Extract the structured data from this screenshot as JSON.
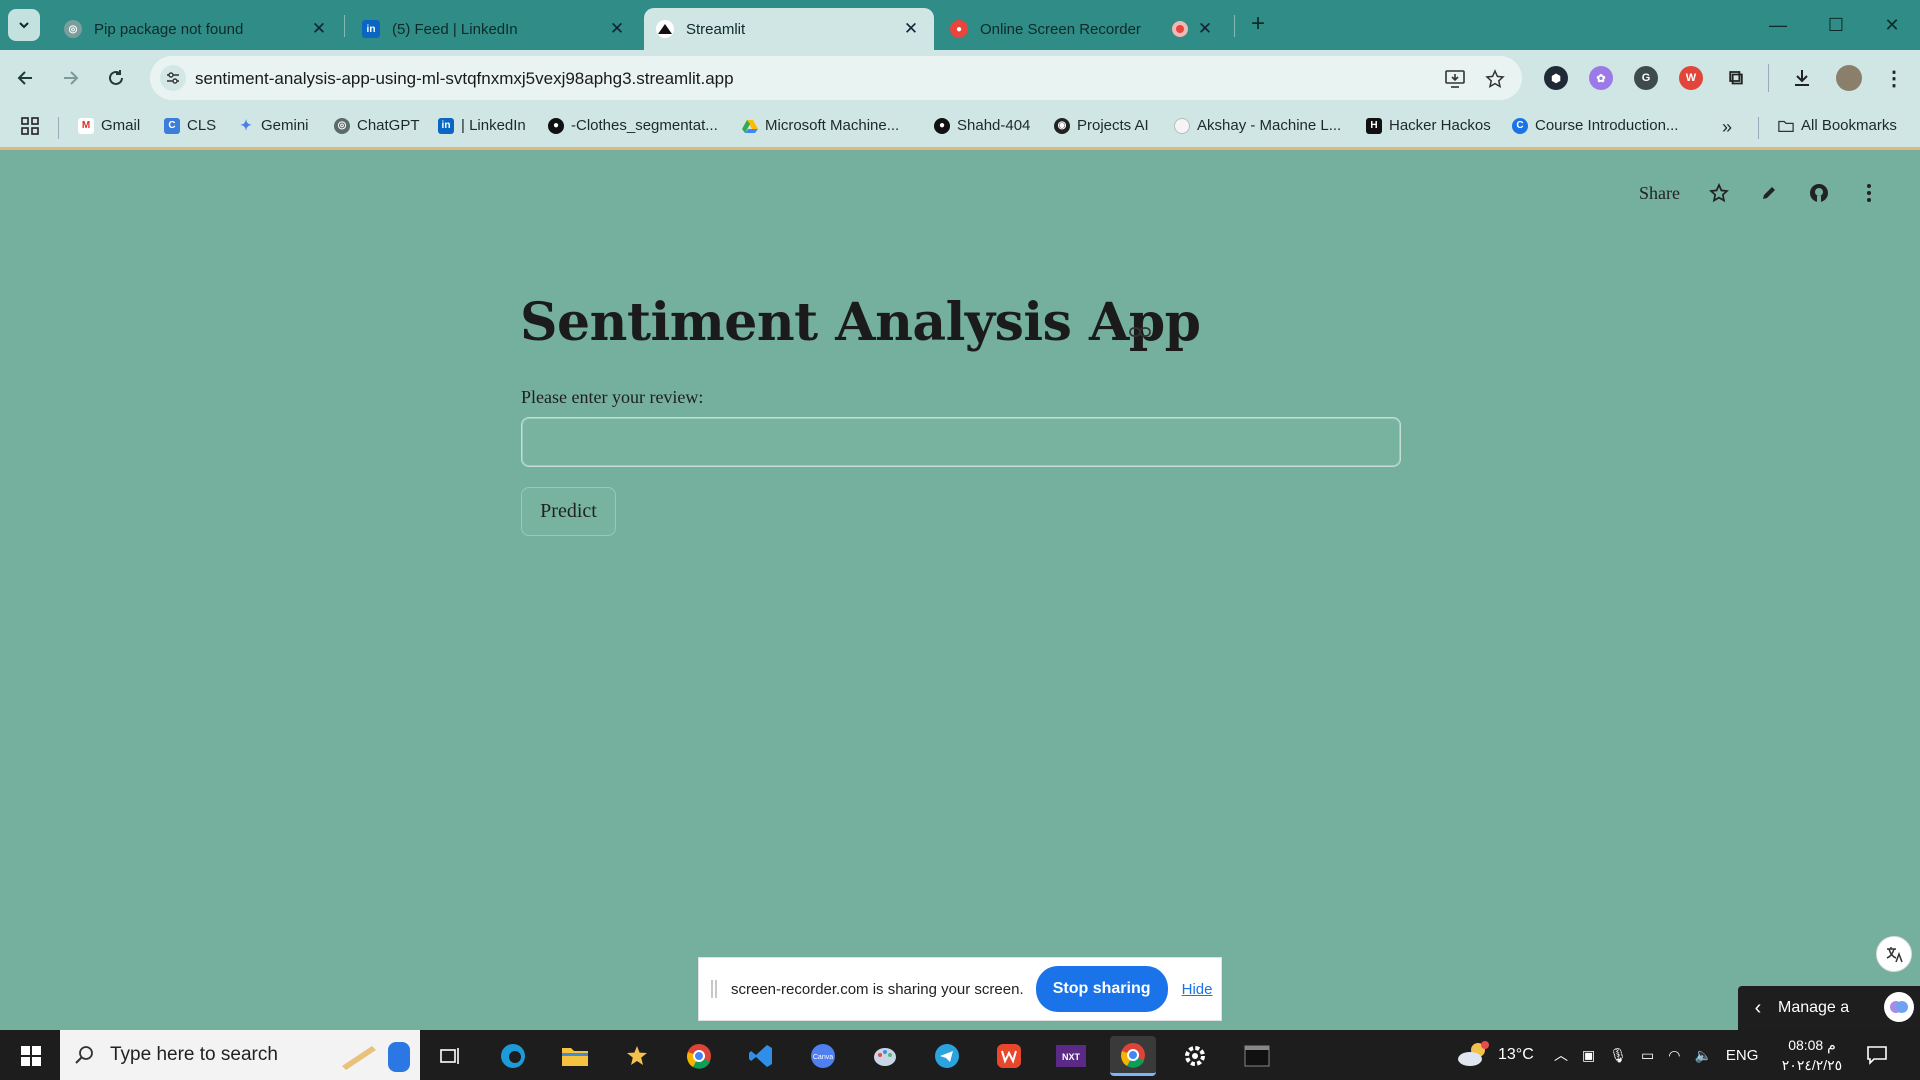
{
  "browser": {
    "tabs": [
      {
        "title": "Pip package not found",
        "active": false
      },
      {
        "title": "(5) Feed | LinkedIn",
        "active": false
      },
      {
        "title": "Streamlit",
        "active": true
      },
      {
        "title": "Online Screen Recorder",
        "active": false
      }
    ],
    "url": "sentiment-analysis-app-using-ml-svtqfnxmxj5vexj98aphg3.streamlit.app",
    "bookmarks": [
      "Gmail",
      "CLS",
      "Gemini",
      "ChatGPT",
      "| LinkedIn",
      "-Clothes_segmentat...",
      "Microsoft Machine...",
      "Shahd-404",
      "Projects AI",
      "Akshay - Machine L...",
      "Hacker Hackos",
      "Course Introduction..."
    ],
    "all_bookmarks": "All Bookmarks"
  },
  "app": {
    "header": {
      "share_label": "Share"
    },
    "title": "Sentiment Analysis App",
    "review_label": "Please enter your review:",
    "review_value": "",
    "predict_label": "Predict"
  },
  "share_bar": {
    "message": "screen-recorder.com is sharing your screen.",
    "stop_label": "Stop sharing",
    "hide_label": "Hide"
  },
  "manage_panel": {
    "label": "Manage a"
  },
  "taskbar": {
    "search_placeholder": "Type here to search",
    "weather": "13°C",
    "language": "ENG",
    "time": "08:08 م",
    "date": "٢٠٢٤/٢/٢٥"
  },
  "colors": {
    "app_background": "#74b09d",
    "tab_strip": "#2f8c86",
    "toolbar": "#cfe6e4",
    "stop_button": "#1a73e8"
  }
}
